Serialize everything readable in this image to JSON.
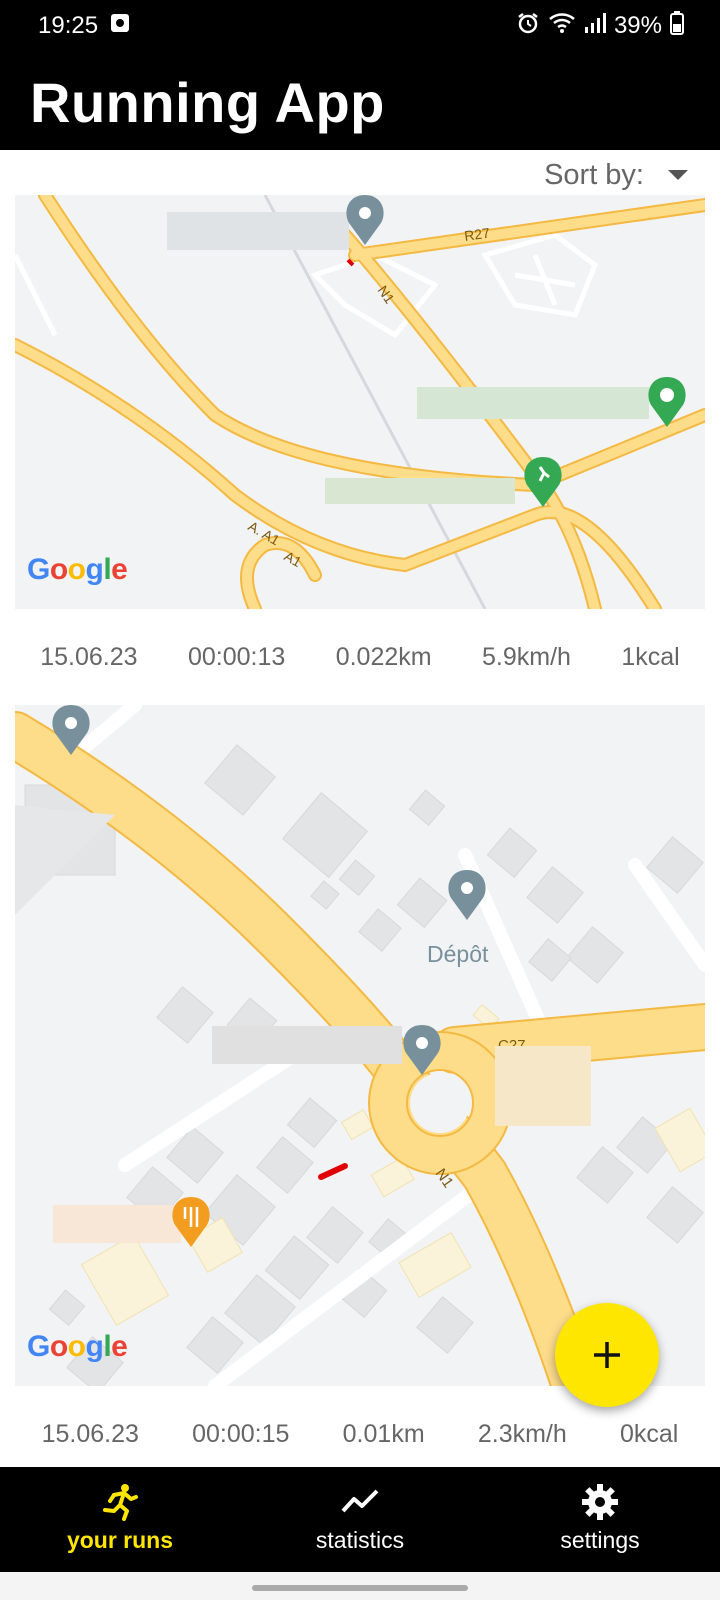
{
  "status_bar": {
    "time": "19:25",
    "battery": "39%"
  },
  "app": {
    "title": "Running App"
  },
  "sort": {
    "label": "Sort by:"
  },
  "runs": [
    {
      "map": {
        "road_labels": [
          "R27",
          "N1",
          "A. A1",
          "A1"
        ],
        "logo": "Google"
      },
      "date": "15.06.23",
      "duration": "00:00:13",
      "distance": "0.022km",
      "speed": "5.9km/h",
      "calories": "1kcal"
    },
    {
      "map": {
        "place_label": "Dépôt",
        "road_labels": [
          "N1",
          "C27"
        ],
        "logo": "Google"
      },
      "date": "15.06.23",
      "duration": "00:00:15",
      "distance": "0.01km",
      "speed": "2.3km/h",
      "calories": "0kcal"
    }
  ],
  "fab": {
    "icon": "plus-icon"
  },
  "nav": {
    "items": [
      {
        "label": "your runs",
        "icon": "runner-icon",
        "active": true
      },
      {
        "label": "statistics",
        "icon": "trend-icon",
        "active": false
      },
      {
        "label": "settings",
        "icon": "gear-icon",
        "active": false
      }
    ]
  },
  "colors": {
    "accent": "#ffe600",
    "road": "#fddc8a",
    "road_edge": "#f4b942",
    "map_bg": "#f2f3f5",
    "route": "#e00000"
  }
}
